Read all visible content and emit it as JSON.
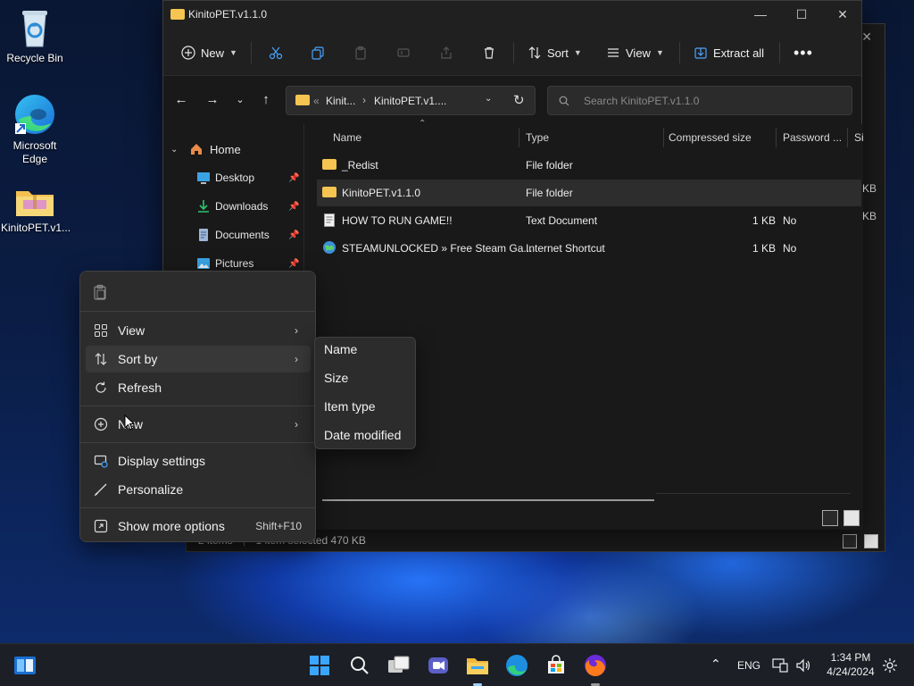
{
  "desktop": {
    "icons": [
      {
        "label": "Recycle Bin"
      },
      {
        "label": "Microsoft Edge"
      },
      {
        "label": "KinitoPET.v1..."
      }
    ]
  },
  "back_window": {
    "status_count": "2 items",
    "status_selection": "1 item selected  470 KB"
  },
  "explorer": {
    "title": "KinitoPET.v1.1.0",
    "toolbar": {
      "new_label": "New",
      "sort_label": "Sort",
      "view_label": "View",
      "extract_label": "Extract all"
    },
    "address": {
      "prefix": "«",
      "parent": "Kinit...",
      "current": "KinitoPET.v1...."
    },
    "search": {
      "placeholder": "Search KinitoPET.v1.1.0"
    },
    "sidebar": {
      "home": "Home",
      "items": [
        {
          "label": "Desktop"
        },
        {
          "label": "Downloads"
        },
        {
          "label": "Documents"
        },
        {
          "label": "Pictures"
        }
      ]
    },
    "columns": {
      "name": "Name",
      "type": "Type",
      "compressed": "Compressed size",
      "password": "Password ...",
      "size": "Si"
    },
    "files": [
      {
        "name": "_Redist",
        "type": "File folder",
        "compressed": "",
        "password": "",
        "icon": "folder-icon"
      },
      {
        "name": "KinitoPET.v1.1.0",
        "type": "File folder",
        "compressed": "",
        "password": "",
        "icon": "folder-icon"
      },
      {
        "name": "HOW TO RUN GAME!!",
        "type": "Text Document",
        "compressed": "1 KB",
        "password": "No",
        "icon": "text-document-icon"
      },
      {
        "name": "STEAMUNLOCKED » Free Steam Ga...",
        "type": "Internet Shortcut",
        "compressed": "1 KB",
        "password": "No",
        "icon": "internet-shortcut-icon"
      }
    ],
    "partial_column_values": [
      "KB",
      "KB"
    ]
  },
  "context_menu": {
    "items": {
      "view": "View",
      "sort_by": "Sort by",
      "refresh": "Refresh",
      "new": "New",
      "display_settings": "Display settings",
      "personalize": "Personalize",
      "show_more": "Show more options",
      "show_more_shortcut": "Shift+F10"
    },
    "sort_submenu": [
      "Name",
      "Size",
      "Item type",
      "Date modified"
    ]
  },
  "taskbar": {
    "language": "ENG",
    "time": "1:34 PM",
    "date": "4/24/2024"
  },
  "colors": {
    "accent": "#0078d4",
    "folder": "#f5c451",
    "window_bg": "#191919",
    "menu_bg": "#2c2c2c"
  }
}
